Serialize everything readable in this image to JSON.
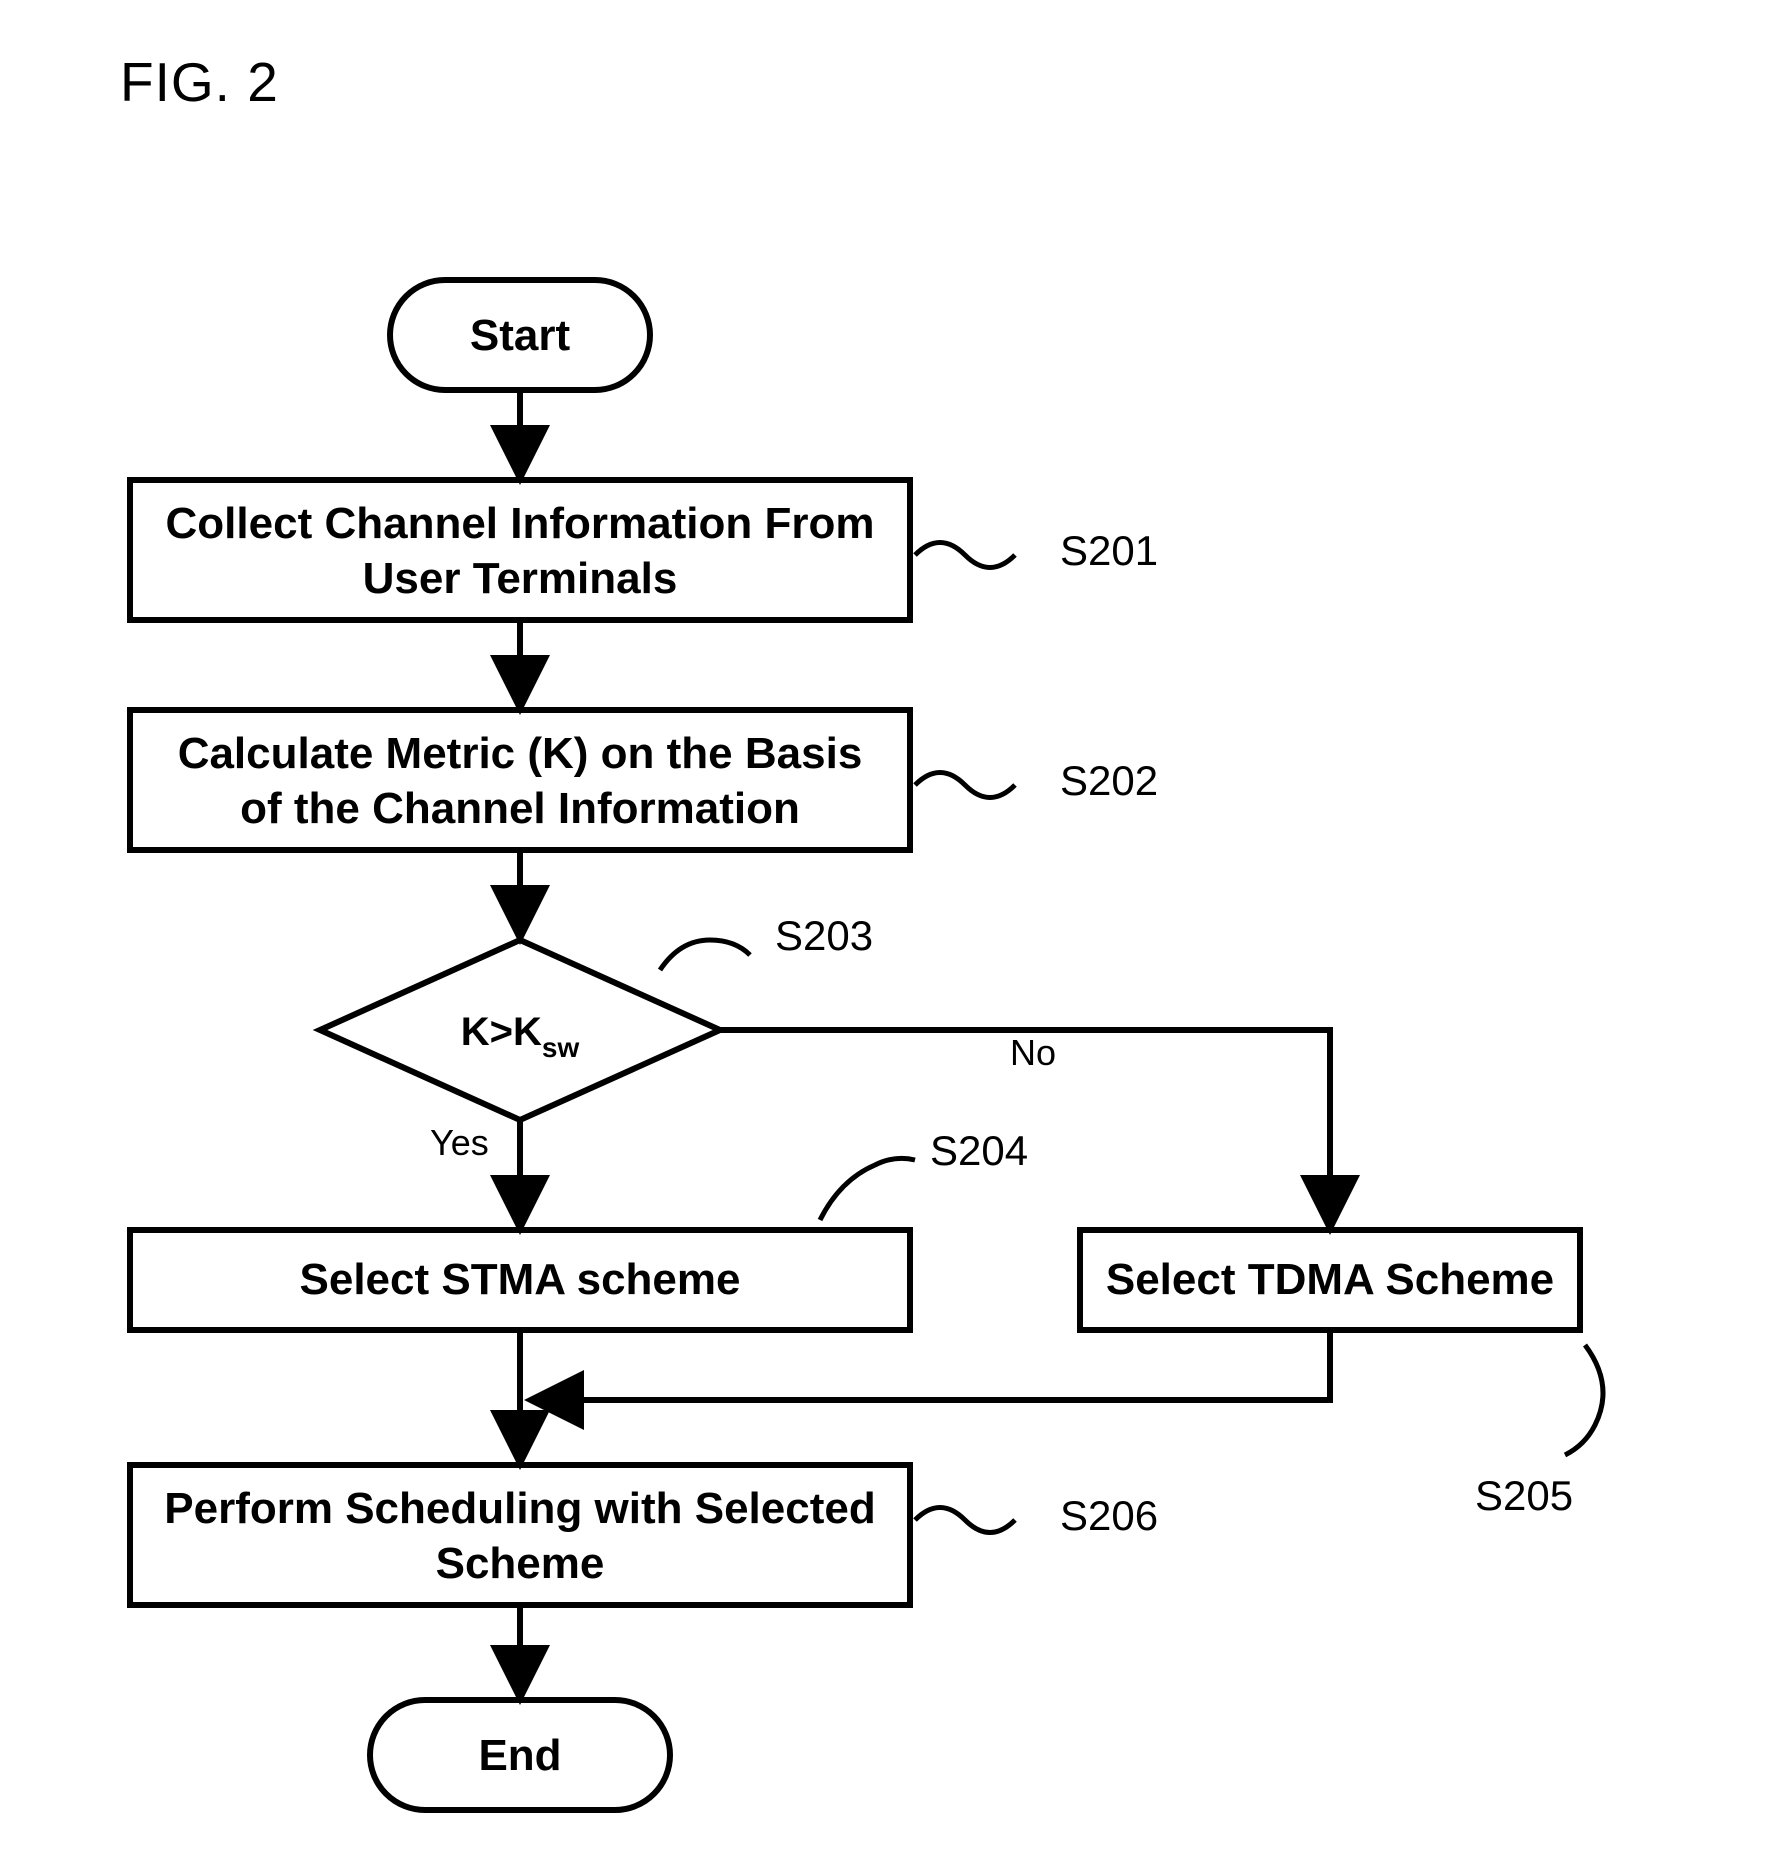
{
  "figure_label": "FIG. 2",
  "nodes": {
    "start": "Start",
    "end": "End",
    "s201": {
      "line1": "Collect Channel Information From",
      "line2": "User Terminals",
      "label": "S201"
    },
    "s202": {
      "line1": "Calculate Metric  (K) on the Basis",
      "line2": "of the Channel Information",
      "label": "S202"
    },
    "s203": {
      "text_prefix": "K>K",
      "text_sub": "sw",
      "label": "S203"
    },
    "s204": {
      "text": "Select STMA scheme",
      "label": "S204"
    },
    "s205": {
      "text": "Select TDMA Scheme",
      "label": "S205"
    },
    "s206": {
      "line1": "Perform Scheduling with Selected",
      "line2": "Scheme",
      "label": "S206"
    }
  },
  "edges": {
    "yes": "Yes",
    "no": "No"
  },
  "chart_data": {
    "type": "flowchart",
    "nodes": [
      {
        "id": "start",
        "type": "terminator",
        "text": "Start"
      },
      {
        "id": "S201",
        "type": "process",
        "text": "Collect Channel Information From User Terminals"
      },
      {
        "id": "S202",
        "type": "process",
        "text": "Calculate Metric (K) on the Basis of the Channel Information"
      },
      {
        "id": "S203",
        "type": "decision",
        "text": "K > K_sw"
      },
      {
        "id": "S204",
        "type": "process",
        "text": "Select STMA scheme"
      },
      {
        "id": "S205",
        "type": "process",
        "text": "Select TDMA Scheme"
      },
      {
        "id": "S206",
        "type": "process",
        "text": "Perform Scheduling with Selected Scheme"
      },
      {
        "id": "end",
        "type": "terminator",
        "text": "End"
      }
    ],
    "edges": [
      {
        "from": "start",
        "to": "S201"
      },
      {
        "from": "S201",
        "to": "S202"
      },
      {
        "from": "S202",
        "to": "S203"
      },
      {
        "from": "S203",
        "to": "S204",
        "label": "Yes"
      },
      {
        "from": "S203",
        "to": "S205",
        "label": "No"
      },
      {
        "from": "S204",
        "to": "S206"
      },
      {
        "from": "S205",
        "to": "S206"
      },
      {
        "from": "S206",
        "to": "end"
      }
    ]
  }
}
